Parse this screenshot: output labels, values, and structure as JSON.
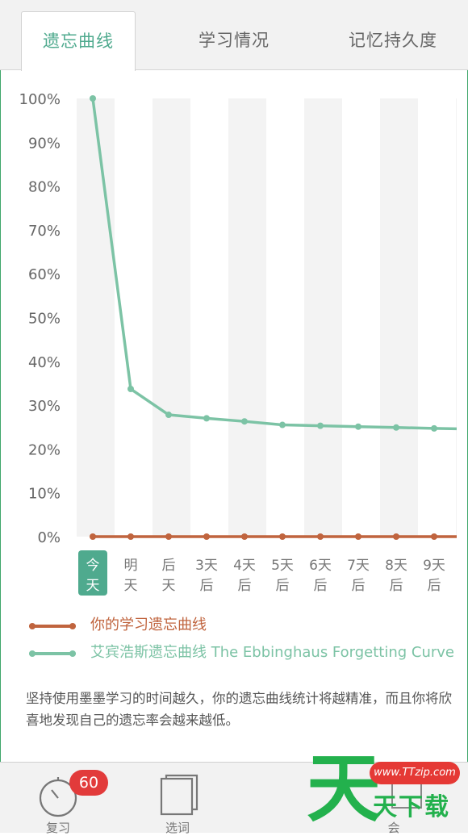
{
  "tabs": [
    {
      "label": "遗忘曲线",
      "active": true
    },
    {
      "label": "学习情况",
      "active": false
    },
    {
      "label": "记忆持久度",
      "active": false
    }
  ],
  "colors": {
    "accent": "#4faa8e",
    "user_curve": "#c0643e",
    "ebbinghaus_curve": "#7cc3a5",
    "badge": "#e23b3b",
    "watermark_green": "#23b14d",
    "watermark_red": "#e53935"
  },
  "chart_data": {
    "type": "line",
    "categories": [
      "今天",
      "明天",
      "后天",
      "3天后",
      "4天后",
      "5天后",
      "6天后",
      "7天后",
      "8天后",
      "9天后"
    ],
    "x_tick_lines": [
      [
        "今",
        "天"
      ],
      [
        "明",
        "天"
      ],
      [
        "后",
        "天"
      ],
      [
        "3天",
        "后"
      ],
      [
        "4天",
        "后"
      ],
      [
        "5天",
        "后"
      ],
      [
        "6天",
        "后"
      ],
      [
        "7天",
        "后"
      ],
      [
        "8天",
        "后"
      ],
      [
        "9天",
        "后"
      ]
    ],
    "highlighted_category": "今天",
    "yticks": [
      "0%",
      "10%",
      "20%",
      "30%",
      "40%",
      "50%",
      "60%",
      "70%",
      "80%",
      "90%",
      "100%"
    ],
    "ylim": [
      0,
      100
    ],
    "grid": "alternating vertical bands",
    "series": [
      {
        "name": "你的学习遗忘曲线",
        "values": [
          0,
          0,
          0,
          0,
          0,
          0,
          0,
          0,
          0,
          0,
          0
        ],
        "color": "#c0643e"
      },
      {
        "name": "艾宾浩斯遗忘曲线 The Ebbinghaus Forgetting Curve",
        "values": [
          100,
          33.7,
          27.8,
          27,
          26.3,
          25.5,
          25.3,
          25.1,
          24.9,
          24.7,
          24.6
        ],
        "color": "#7cc3a5"
      }
    ],
    "legend": [
      {
        "label": "你的学习遗忘曲线",
        "color": "#c0643e"
      },
      {
        "label": "艾宾浩斯遗忘曲线 The Ebbinghaus Forgetting Curve",
        "color": "#7cc3a5"
      }
    ]
  },
  "description": "坚持使用墨墨学习的时间越久，你的遗忘曲线统计将越精准，而且你将欣喜地发现自己的遗忘率会越来越低。",
  "bottom_nav": [
    {
      "label": "复习",
      "icon": "stopwatch-icon",
      "badge": "60"
    },
    {
      "label": "选词",
      "icon": "book-stack-icon"
    },
    {
      "label": "会",
      "icon": "grid-icon"
    }
  ],
  "watermark": {
    "big": "天",
    "url": "www.TTzip.com",
    "sub": "天下载"
  }
}
